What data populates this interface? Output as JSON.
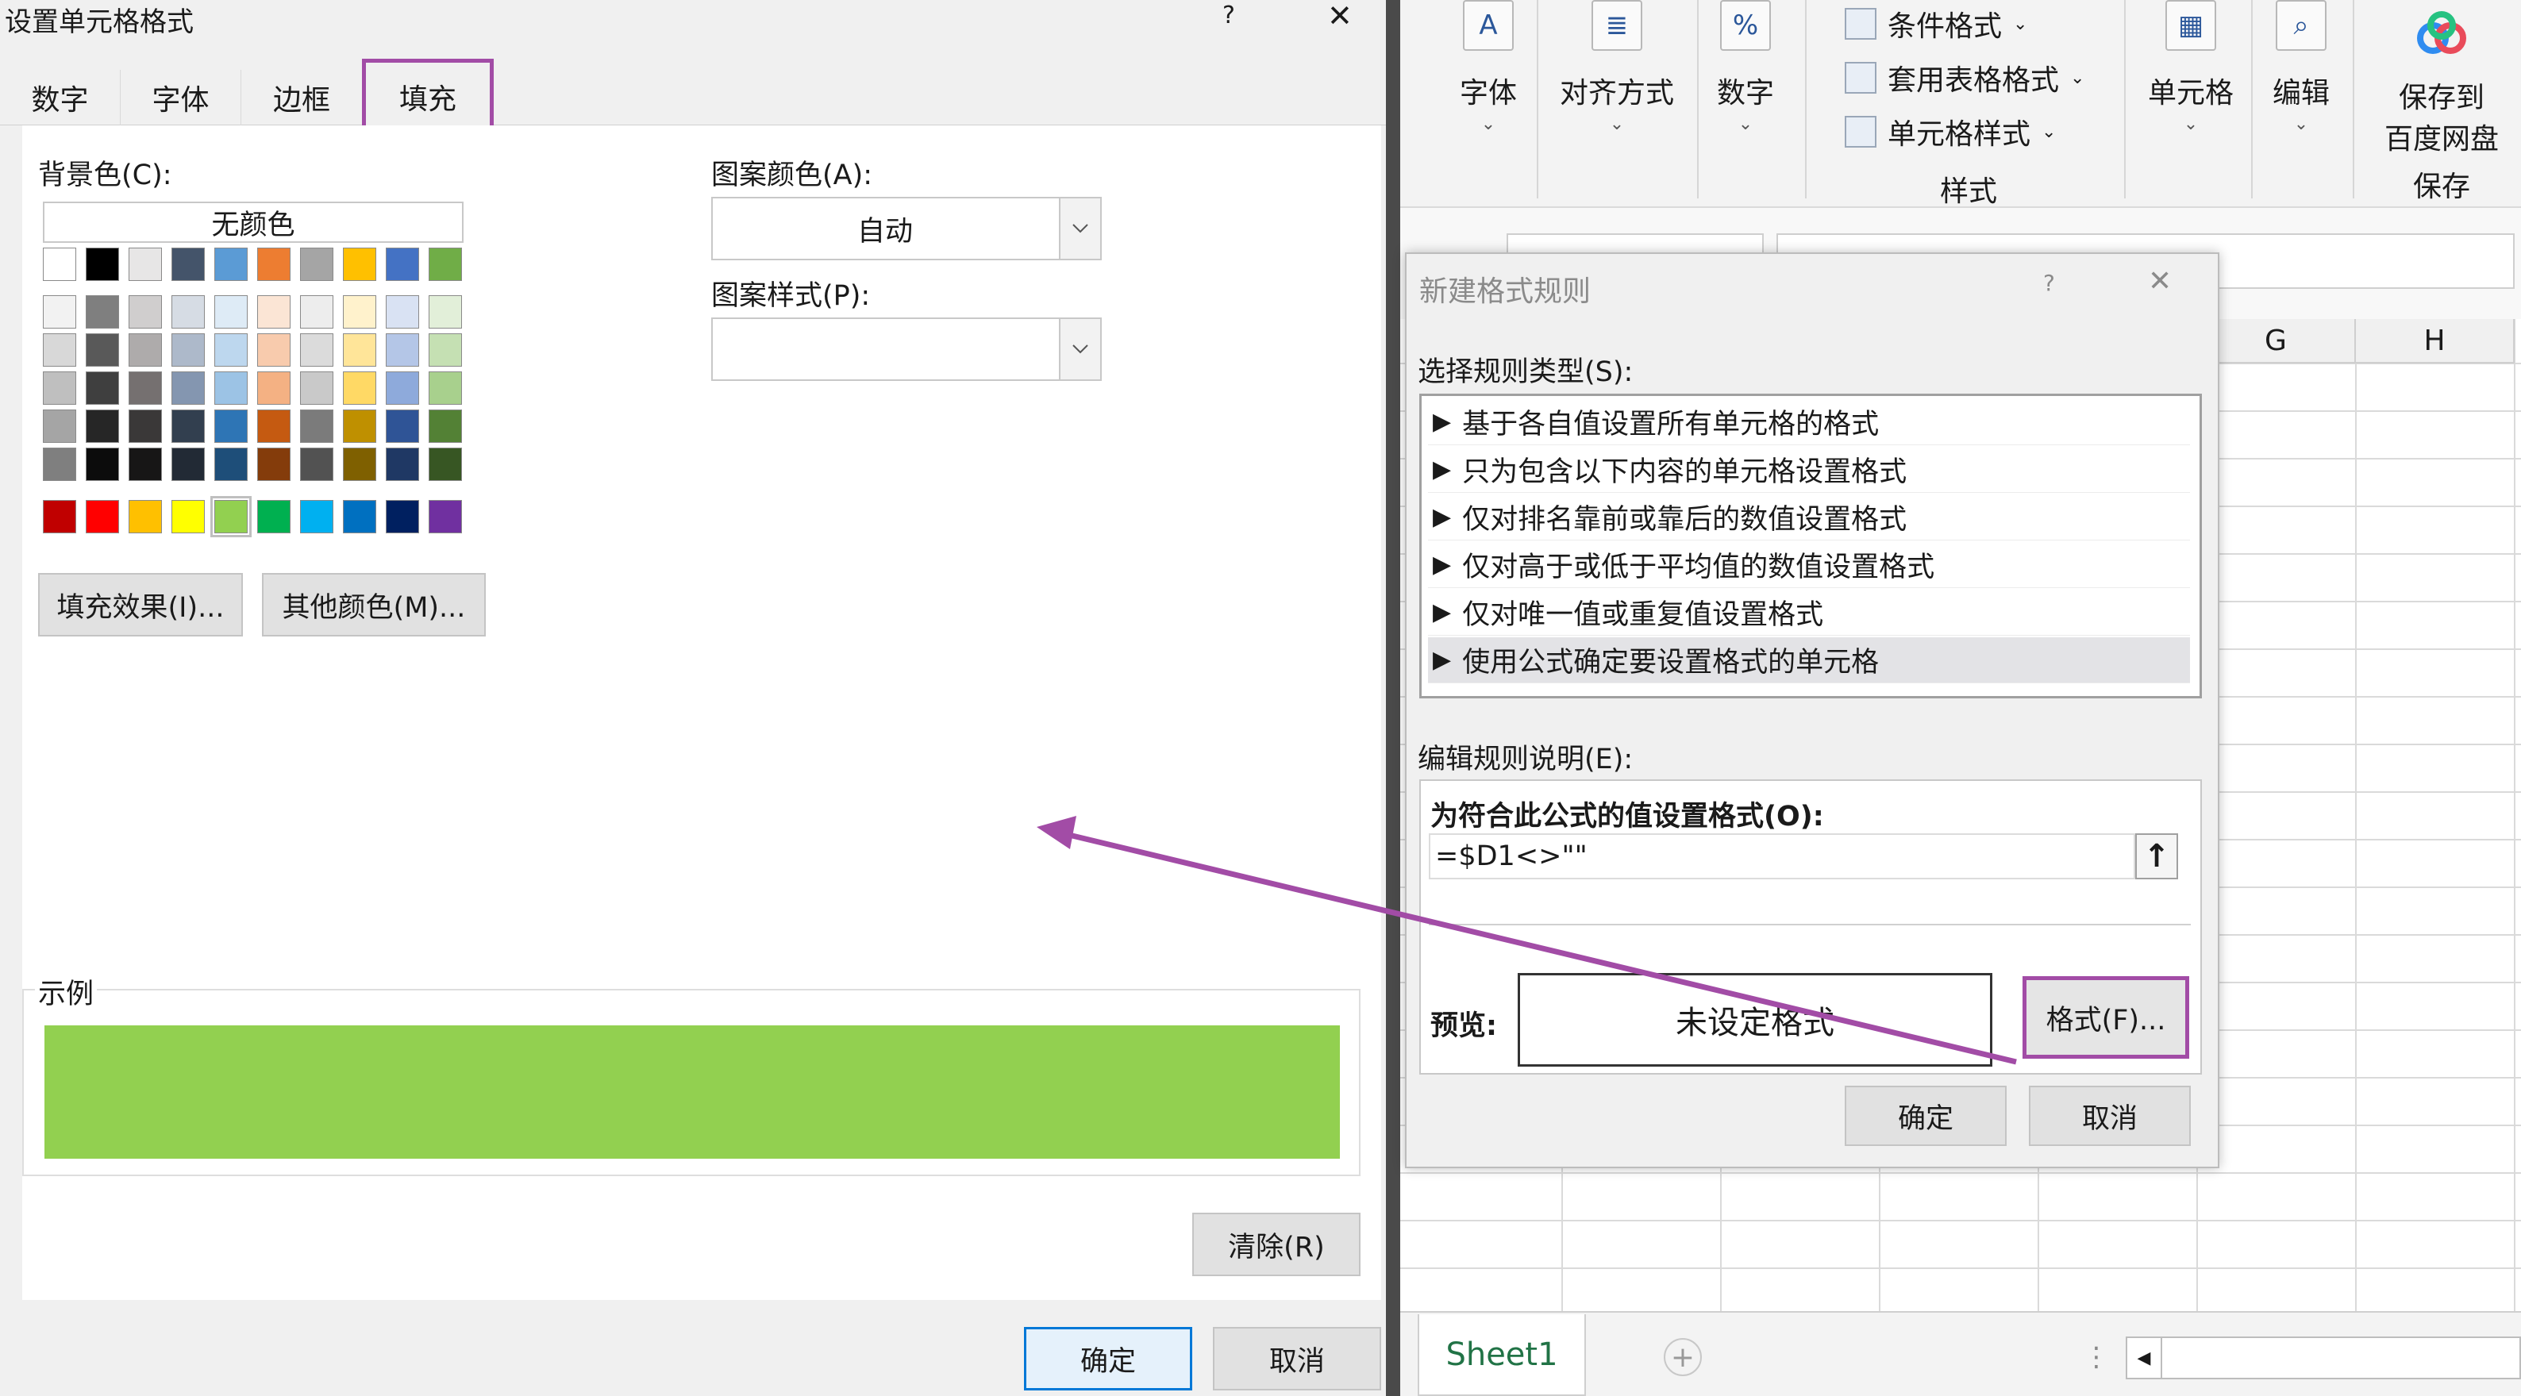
{
  "format_cells": {
    "title": "设置单元格格式",
    "help": "?",
    "close": "✕",
    "tabs": [
      "数字",
      "字体",
      "边框",
      "填充"
    ],
    "bg_color_label": "背景色(C):",
    "no_color": "无颜色",
    "fill_effects": "填充效果(I)...",
    "more_colors": "其他颜色(M)...",
    "pattern_color_label": "图案颜色(A):",
    "pattern_color_value": "自动",
    "pattern_style_label": "图案样式(P):",
    "pattern_style_value": "",
    "sample_label": "示例",
    "sample_color": "#92D050",
    "clear": "清除(R)",
    "ok": "确定",
    "cancel": "取消",
    "palette": {
      "theme_row": [
        "#FFFFFF",
        "#000000",
        "#E7E6E6",
        "#44546A",
        "#5B9BD5",
        "#ED7D31",
        "#A5A5A5",
        "#FFC000",
        "#4472C4",
        "#70AD47"
      ],
      "tints": [
        [
          "#F2F2F2",
          "#7F7F7F",
          "#D0CECE",
          "#D6DCE4",
          "#DEEBF6",
          "#FBE5D5",
          "#EDEDED",
          "#FFF2CC",
          "#D9E2F3",
          "#E2EFD9"
        ],
        [
          "#D8D8D8",
          "#595959",
          "#AEABAB",
          "#ADB9CA",
          "#BDD7EE",
          "#F8CBAD",
          "#DBDBDB",
          "#FFE599",
          "#B4C6E7",
          "#C5E0B3"
        ],
        [
          "#BFBFBF",
          "#3F3F3F",
          "#757070",
          "#8496B0",
          "#9CC3E5",
          "#F4B183",
          "#C9C9C9",
          "#FFD965",
          "#8EAADB",
          "#A8D08D"
        ],
        [
          "#A5A5A5",
          "#262626",
          "#3A3838",
          "#323F4F",
          "#2E75B5",
          "#C55A11",
          "#7B7B7B",
          "#BF9000",
          "#2F5496",
          "#538135"
        ],
        [
          "#7F7F7F",
          "#0C0C0C",
          "#171616",
          "#222A35",
          "#1E4E79",
          "#843C0B",
          "#525252",
          "#7F6000",
          "#1F3864",
          "#375623"
        ]
      ],
      "standard_row": [
        "#C00000",
        "#FF0000",
        "#FFC000",
        "#FFFF00",
        "#92D050",
        "#00B050",
        "#00B0F0",
        "#0070C0",
        "#002060",
        "#7030A0"
      ]
    }
  },
  "ribbon": {
    "font": "字体",
    "alignment": "对齐方式",
    "number": "数字",
    "conditional_format": "条件格式",
    "table_format": "套用表格格式",
    "cell_styles": "单元格样式",
    "styles_group": "样式",
    "cells": "单元格",
    "edit": "编辑",
    "save_to_baidu_line1": "保存到",
    "save_to_baidu_line2": "百度网盘",
    "save_group": "保存"
  },
  "sheet": {
    "columns": [
      "G",
      "H"
    ],
    "tab": "Sheet1"
  },
  "new_rule": {
    "title": "新建格式规则",
    "help": "?",
    "close": "✕",
    "rule_type_label": "选择规则类型(S):",
    "rules": [
      "基于各自值设置所有单元格的格式",
      "只为包含以下内容的单元格设置格式",
      "仅对排名靠前或靠后的数值设置格式",
      "仅对高于或低于平均值的数值设置格式",
      "仅对唯一值或重复值设置格式",
      "使用公式确定要设置格式的单元格"
    ],
    "selected_rule_index": 5,
    "edit_desc_label": "编辑规则说明(E):",
    "formula_label": "为符合此公式的值设置格式(O):",
    "formula_value": "=$D1<>\"\"",
    "preview_label": "预览:",
    "preview_text": "未设定格式",
    "format_button": "格式(F)...",
    "ok": "确定",
    "cancel": "取消"
  },
  "colors": {
    "highlight": "#A24CA6",
    "accent": "#0078D7"
  }
}
